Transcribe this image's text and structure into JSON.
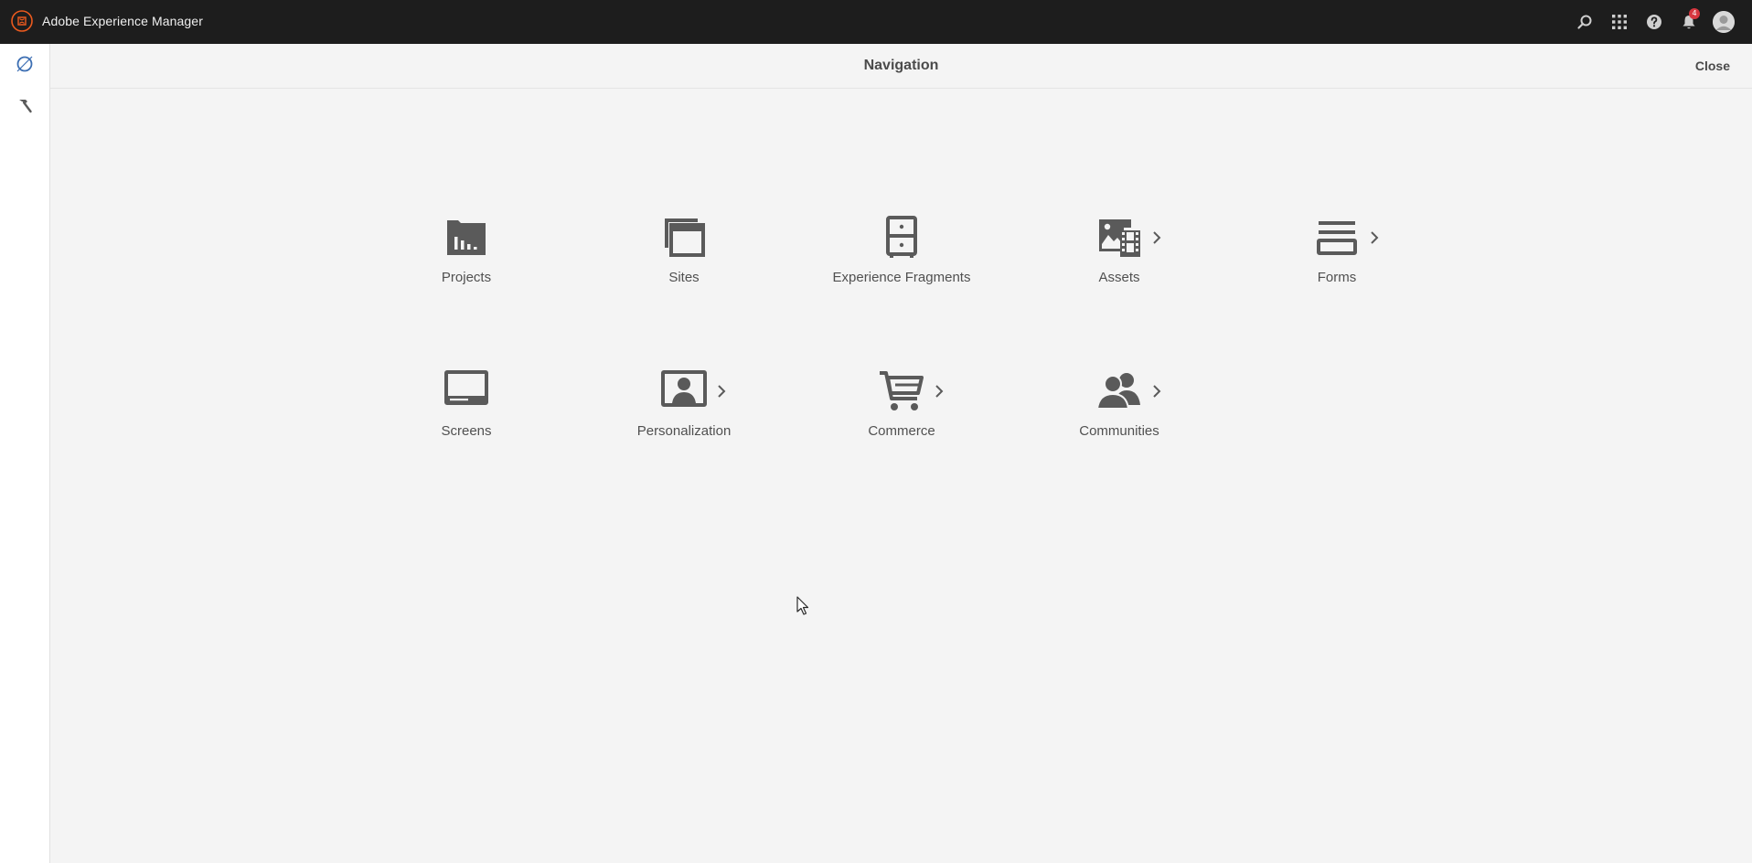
{
  "app": {
    "title": "Adobe Experience Manager",
    "brand_color": "#eb5a1e"
  },
  "topbar": {
    "search_icon": "search-icon",
    "solutions_icon": "grid-icon",
    "help_icon": "help-icon",
    "notifications_icon": "bell-icon",
    "notifications_count": "4",
    "profile_icon": "avatar"
  },
  "rail": {
    "items": [
      {
        "name": "navigation",
        "icon": "compass-icon",
        "active": true
      },
      {
        "name": "tools",
        "icon": "hammer-icon",
        "active": false
      }
    ]
  },
  "navigation": {
    "title": "Navigation",
    "close_label": "Close",
    "tiles": [
      {
        "label": "Projects",
        "icon": "projects-folder-icon",
        "has_children": false
      },
      {
        "label": "Sites",
        "icon": "sites-windows-icon",
        "has_children": false
      },
      {
        "label": "Experience Fragments",
        "icon": "drawer-cabinet-icon",
        "has_children": false
      },
      {
        "label": "Assets",
        "icon": "image-film-icon",
        "has_children": true
      },
      {
        "label": "Forms",
        "icon": "form-lines-icon",
        "has_children": true
      },
      {
        "label": "Screens",
        "icon": "monitor-icon",
        "has_children": false
      },
      {
        "label": "Personalization",
        "icon": "person-frame-icon",
        "has_children": true
      },
      {
        "label": "Commerce",
        "icon": "shopping-cart-icon",
        "has_children": true
      },
      {
        "label": "Communities",
        "icon": "users-icon",
        "has_children": true
      }
    ]
  },
  "colors": {
    "topbar_bg": "#1d1d1d",
    "panel_bg": "#f4f4f4",
    "icon": "#5a5a5a",
    "rail_active": "#3d6fb3",
    "badge": "#d7373f"
  }
}
